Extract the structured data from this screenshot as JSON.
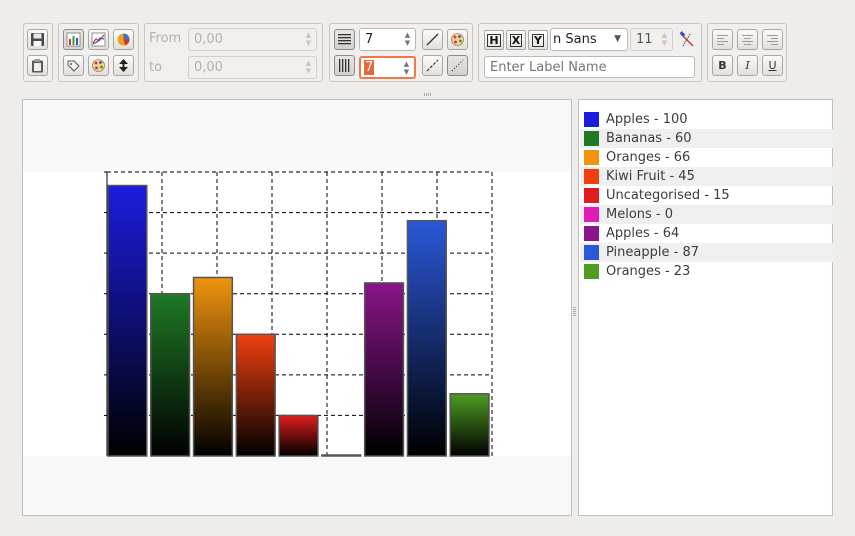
{
  "toolbar": {
    "range": {
      "from_label": "From",
      "to_label": "to",
      "from_value": "0,00",
      "to_value": "0,00"
    },
    "grid": {
      "h_value": "7",
      "v_value": "7"
    },
    "label": {
      "font_name": "n Sans",
      "font_size": "11",
      "placeholder": "Enter Label Name"
    },
    "format_buttons": {
      "h": "H",
      "x": "X",
      "y": "Y"
    },
    "style_buttons": {
      "bold": "B",
      "italic": "I",
      "underline": "U"
    }
  },
  "chart_data": {
    "type": "bar",
    "categories": [
      "Apples",
      "Bananas",
      "Oranges",
      "Kiwi Fruit",
      "Uncategorised",
      "Melons",
      "Apples",
      "Pineapple",
      "Oranges"
    ],
    "values": [
      100,
      60,
      66,
      45,
      15,
      0,
      64,
      87,
      23
    ],
    "colors": [
      "#1c1ce0",
      "#1e7a25",
      "#f0940e",
      "#f04010",
      "#e01c1c",
      "#e01cb4",
      "#8a148a",
      "#2a58d8",
      "#4e9c22"
    ],
    "ylim": [
      0,
      105
    ],
    "grid": true,
    "legend": "right",
    "legend_items": [
      {
        "label": "Apples - 100",
        "color": "#1c1ce0"
      },
      {
        "label": "Bananas - 60",
        "color": "#1e7a25"
      },
      {
        "label": "Oranges - 66",
        "color": "#f0940e"
      },
      {
        "label": "Kiwi Fruit - 45",
        "color": "#f04010"
      },
      {
        "label": "Uncategorised - 15",
        "color": "#e01c1c"
      },
      {
        "label": "Melons - 0",
        "color": "#e01cb4"
      },
      {
        "label": "Apples - 64",
        "color": "#8a148a"
      },
      {
        "label": "Pineapple - 87",
        "color": "#2a58d8"
      },
      {
        "label": "Oranges - 23",
        "color": "#4e9c22"
      }
    ]
  }
}
